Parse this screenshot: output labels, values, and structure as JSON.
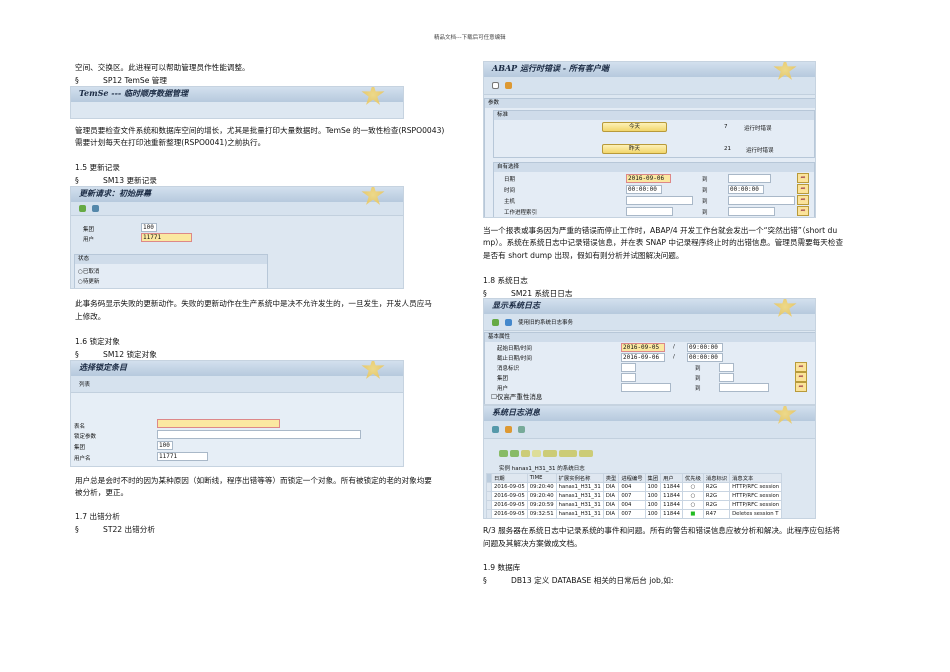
{
  "header": "精品文档---下载后可任意编辑",
  "left": {
    "p0": "空间、交换区。此进程可以帮助管理员作性能调整。",
    "sp12": {
      "mark": "§",
      "text": "SP12 TemSe 管理"
    },
    "temse_title": "TemSe --- 临时顺序数据管理",
    "p1a": "管理员要检查文件系统和数据库空间的增长，尤其是批量打印大量数据时。TemSe 的一致性检查(RSPO0043)",
    "p1b": "需要计划每天在打印池重新整理(RSPO0041)之前执行。",
    "h15": "1.5  更新记录",
    "sm13": {
      "mark": "§",
      "text": "SM13 更新记录"
    },
    "sm13_shot": {
      "title": "更新请求：初始屏幕",
      "client_label": "集团",
      "client": "100",
      "user_label": "用户",
      "user": "11771",
      "status_group": "状态",
      "radio1": "已取消",
      "radio2": "待更新"
    },
    "p2a": "此事务码显示失败的更新动作。失败的更新动作在生产系统中是决不允许发生的，一旦发生，开发人员应马",
    "p2b": "上修改。",
    "h16": "1.6  锁定对象",
    "sm12": {
      "mark": "§",
      "text": "SM12 锁定对象"
    },
    "sm12_shot": {
      "title": "选择锁定条目",
      "menu": "列表",
      "table_label": "表名",
      "table": "",
      "arg_label": "锁定参数",
      "arg": "",
      "client_label": "集团",
      "client": "100",
      "user_label": "用户名",
      "user": "11771"
    },
    "p3a": "用户总是会时不时的因为某种原因（如断线，程序出错等等）而锁定一个对象。所有被锁定的老的对象均要",
    "p3b": "被分析，更正。",
    "h17": "1.7  出错分析",
    "st22": {
      "mark": "§",
      "text": "ST22 出错分析"
    }
  },
  "right": {
    "st22_shot": {
      "title": "ABAP 运行时错误 - 所有客户端",
      "params": "参数",
      "std": "标准",
      "today": "今天",
      "today_count": "7",
      "today_label": "运行时错误",
      "yesterday": "昨天",
      "yesterday_count": "21",
      "yesterday_label": "运行时错误",
      "free": "自有选择",
      "date_label": "日期",
      "date": "2016-09-06",
      "time_label": "时间",
      "time": "00:00:00",
      "time_to": "00:00:00",
      "host_label": "主机",
      "wp_label": "工作进程索引",
      "to": "到"
    },
    "p4a": "当一个报表或事务因为严重的错误而停止工作时，ABAP/4 开发工作台就会发出一个“突然出错”（short du",
    "p4b": "mp）。系统在系统日志中记录错误信息，并在表 SNAP 中记录程序终止时的出错信息。管理员需要每天检查",
    "p4c": "是否有 short dump 出现，假如有则分析并试图解决问题。",
    "h18": "1.8  系统日志",
    "sm21": {
      "mark": "§",
      "text": "SM21 系统日日志"
    },
    "sm21_shot": {
      "title": "显示系统日志",
      "tool_text": "使用旧的系统日志事务",
      "attrs": "基本属性",
      "start_label": "起始日期/时间",
      "start_date": "2016-09-05",
      "start_time": "09:00:00",
      "end_label": "截止日期/时间",
      "end_date": "2016-09-06",
      "end_time": "00:00:00",
      "msgid_label": "消息标识",
      "client_label": "集团",
      "user_label": "用户",
      "to": "到",
      "only_severe": "仅高严重性消息",
      "sep": "/"
    },
    "log_shot": {
      "title": "系统日志消息",
      "instance": "实例 hanas1_H31_31 的系统日志",
      "columns": [
        "日期",
        "TIME",
        "扩展实例名称",
        "类型",
        "进程编号",
        "集团",
        "用户",
        "优先级",
        "消息标识",
        "消息文本"
      ],
      "rows": [
        [
          "2016-09-05",
          "09:20:40",
          "hanas1_H31_31",
          "DIA",
          "004",
          "100",
          "11844",
          "○",
          "R2G",
          "HTTP/RFC session"
        ],
        [
          "2016-09-05",
          "09:20:40",
          "hanas1_H31_31",
          "DIA",
          "007",
          "100",
          "11844",
          "○",
          "R2G",
          "HTTP/RFC session"
        ],
        [
          "2016-09-05",
          "09:20:59",
          "hanas1_H31_31",
          "DIA",
          "004",
          "100",
          "11844",
          "○",
          "R2G",
          "HTTP/RFC session"
        ],
        [
          "2016-09-05",
          "09:32:51",
          "hanas1_H31_31",
          "DIA",
          "007",
          "100",
          "11844",
          "■",
          "R47",
          "Deletes session T"
        ]
      ]
    },
    "p5a": "R/3 服务器在系统日志中记录系统的事件和问题。所有的警告和错误信息应被分析和解决。此程序应包括将",
    "p5b": "问题及其解决方案做成文档。",
    "h19": "1.9  数据库",
    "db13": {
      "mark": "§",
      "text": "DB13 定义 DATABASE 相关的日常后台 job,如:"
    }
  }
}
